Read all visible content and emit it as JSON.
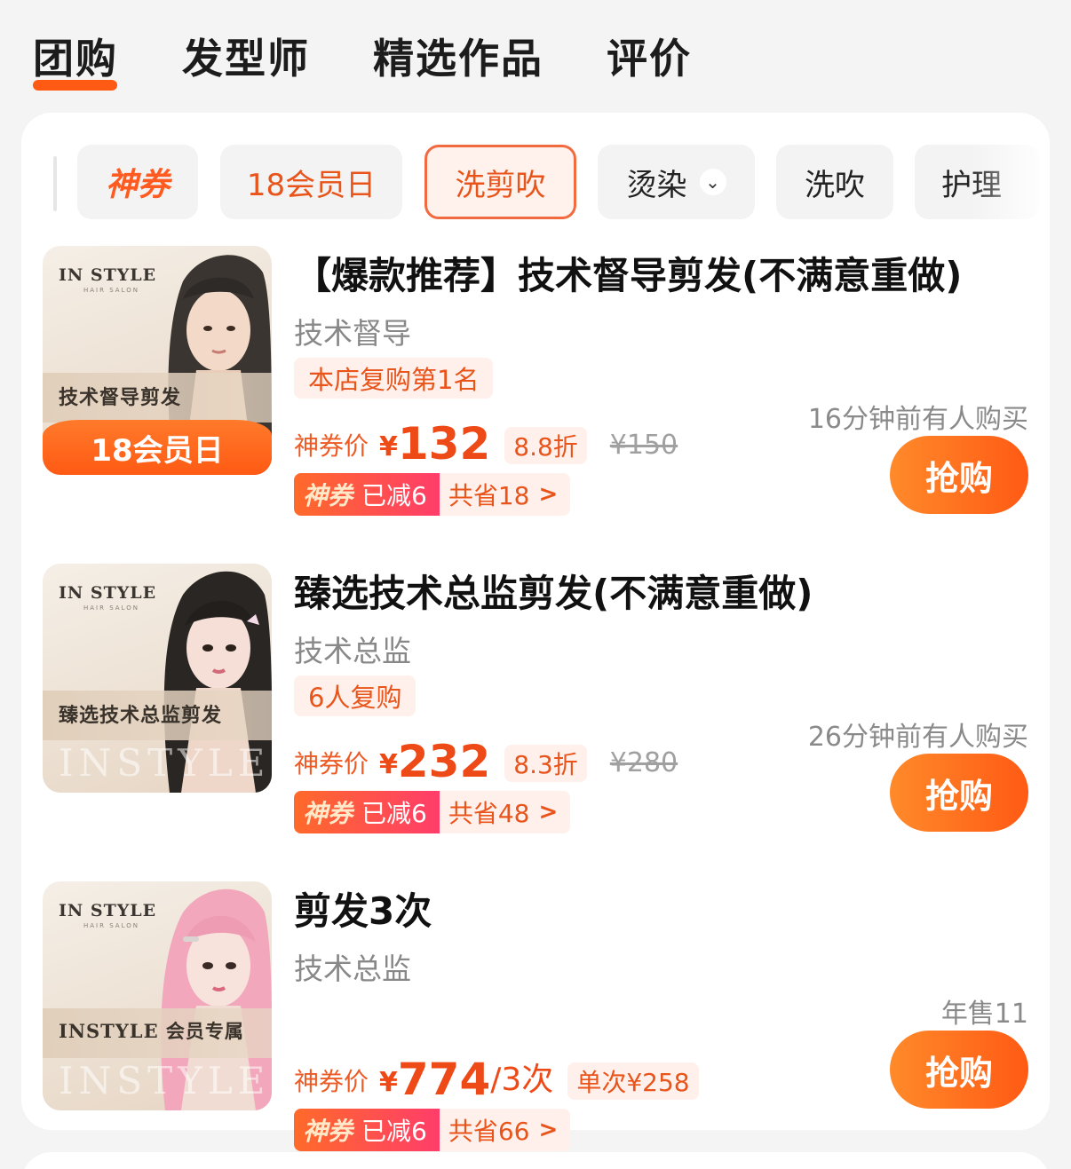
{
  "tabs": [
    "团购",
    "发型师",
    "精选作品",
    "评价"
  ],
  "filters": {
    "coupon": "神券",
    "member_day": "18会员日",
    "wash_cut_blow": "洗剪吹",
    "perm_dye": "烫染",
    "wash_blow": "洗吹",
    "care": "护理"
  },
  "deals": [
    {
      "thumb_brand": "IN STYLE",
      "thumb_brand_sub": "HAIR SALON",
      "thumb_text": "技术督导剪发",
      "thumb_band": "18会员日",
      "title": "【爆款推荐】技术督导剪发(不满意重做)",
      "subtitle": "技术督导",
      "tag": "本店复购第1名",
      "price_label": "神券价",
      "currency": "¥",
      "price": "132",
      "discount": "8.8折",
      "original": "¥150",
      "coupon_name": "神券",
      "coupon_off": "已减6",
      "saved": "共省18",
      "recent": "16分钟前有人购买",
      "buy": "抢购"
    },
    {
      "thumb_brand": "IN STYLE",
      "thumb_brand_sub": "HAIR SALON",
      "thumb_text": "臻选技术总监剪发",
      "thumb_watermark": "INSTYLE",
      "title": "臻选技术总监剪发(不满意重做)",
      "subtitle": "技术总监",
      "tag": "6人复购",
      "price_label": "神券价",
      "currency": "¥",
      "price": "232",
      "discount": "8.3折",
      "original": "¥280",
      "coupon_name": "神券",
      "coupon_off": "已减6",
      "saved": "共省48",
      "recent": "26分钟前有人购买",
      "buy": "抢购"
    },
    {
      "thumb_brand": "IN STYLE",
      "thumb_brand_sub": "HAIR SALON",
      "thumb_text": "INSTYLE 会员专属",
      "thumb_watermark": "INSTYLE",
      "title": "剪发3次",
      "subtitle": "技术总监",
      "price_label": "神券价",
      "currency": "¥",
      "price": "774",
      "price_unit": "/3次",
      "discount": "单次¥258",
      "coupon_name": "神券",
      "coupon_off": "已减6",
      "saved": "共省66",
      "recent": "年售11",
      "buy": "抢购"
    }
  ],
  "icons": {
    "chevron": "chevron-down-icon",
    "arrow": "chevron-right-icon"
  },
  "colors": {
    "accent": "#ff5a14",
    "price": "#ee4a17",
    "tag_bg": "#fff0eb"
  }
}
